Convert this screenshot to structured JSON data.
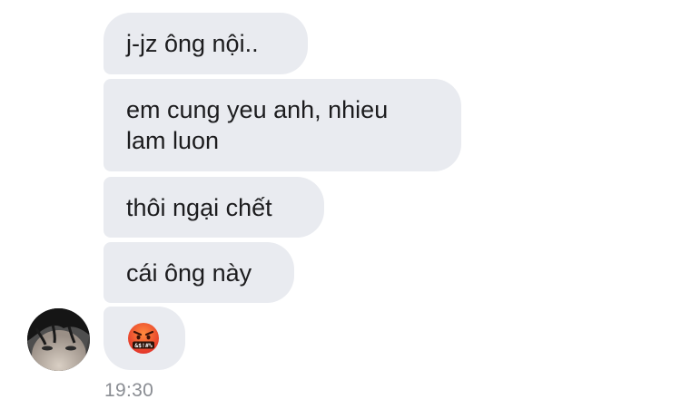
{
  "conversation": {
    "messages": [
      {
        "text": "j-jz ông nội.."
      },
      {
        "text": "em cung yeu anh, nhieu\nlam luon"
      },
      {
        "text": "thôi ngại chết"
      },
      {
        "text": "cái ông này"
      },
      {
        "emoji": "face-with-symbols-on-mouth-icon",
        "emoji_text": "&$!#%"
      }
    ],
    "timestamp": "19:30",
    "avatar": {
      "icon": "user-avatar-photo"
    }
  },
  "colors": {
    "bubble_background": "#e9ebf0",
    "text": "#1c1c1e",
    "timestamp": "#8a8d93",
    "emoji_face": "#e8472b"
  }
}
